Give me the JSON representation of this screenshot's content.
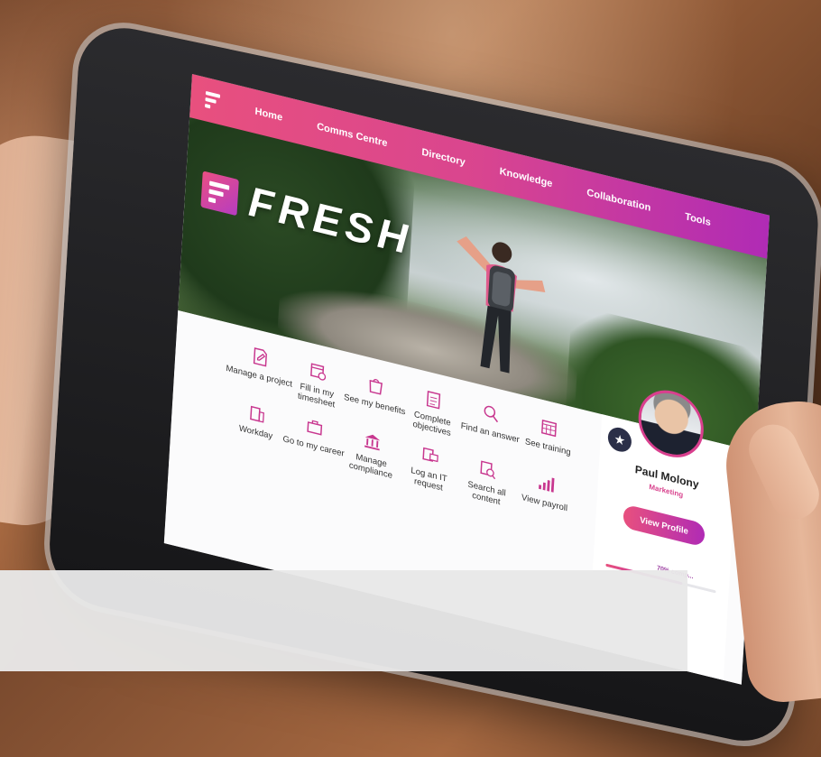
{
  "nav": {
    "items": [
      "Home",
      "Comms Centre",
      "Directory",
      "Knowledge",
      "Collaboration",
      "Tools"
    ]
  },
  "brand": {
    "name": "FRESH"
  },
  "tiles": [
    {
      "label": "Manage a project",
      "icon": "document-pen-icon"
    },
    {
      "label": "Fill in my timesheet",
      "icon": "calendar-clock-icon"
    },
    {
      "label": "See my benefits",
      "icon": "shopping-bag-icon"
    },
    {
      "label": "Complete objectives",
      "icon": "clipboard-list-icon"
    },
    {
      "label": "Find an answer",
      "icon": "search-icon"
    },
    {
      "label": "See training",
      "icon": "calendar-grid-icon"
    },
    {
      "label": "Workday",
      "icon": "building-icon"
    },
    {
      "label": "Go to my career",
      "icon": "briefcase-icon"
    },
    {
      "label": "Manage compliance",
      "icon": "bank-icon"
    },
    {
      "label": "Log an IT request",
      "icon": "computer-icon"
    },
    {
      "label": "Search all content",
      "icon": "search-document-icon"
    },
    {
      "label": "View payroll",
      "icon": "bar-chart-icon"
    }
  ],
  "profile": {
    "name": "Paul Molony",
    "role": "Marketing",
    "button": "View Profile",
    "progress_label": "70% comp...",
    "progress": 0.7
  },
  "colors": {
    "accent_start": "#e8507e",
    "accent_end": "#b02bb5",
    "badge_bg": "#2b2f48"
  }
}
